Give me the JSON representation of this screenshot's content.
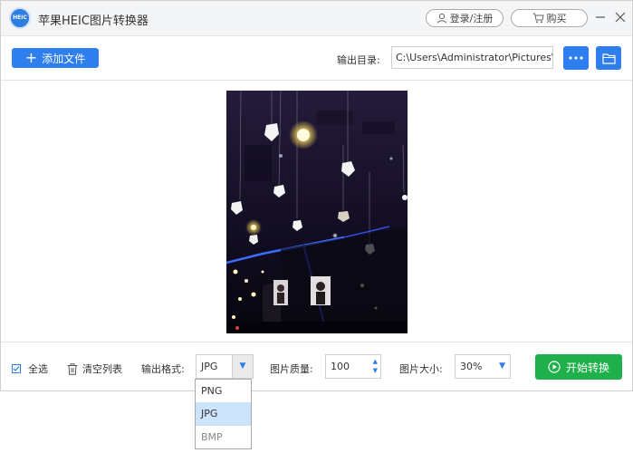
{
  "app": {
    "logo_text": "HEIC",
    "title": "苹果HEIC图片转换器"
  },
  "header": {
    "login_label": "登录/注册",
    "buy_label": "购买"
  },
  "toolbar": {
    "add_label": "添加文件",
    "output_label": "输出目录:",
    "output_path": "C:\\Users\\Administrator\\Pictures\\"
  },
  "bottom": {
    "select_all_label": "全选",
    "select_all_checked": true,
    "clear_label": "清空列表",
    "format_label": "输出格式:",
    "format_value": "JPG",
    "quality_label": "图片质量:",
    "quality_value": "100",
    "size_label": "图片大小:",
    "size_value": "30%",
    "start_label": "开始转换"
  },
  "format_dropdown": {
    "options": [
      "PNG",
      "JPG",
      "BMP"
    ],
    "selected": "JPG"
  },
  "colors": {
    "accent": "#2e7ef0",
    "start": "#20b04b"
  }
}
